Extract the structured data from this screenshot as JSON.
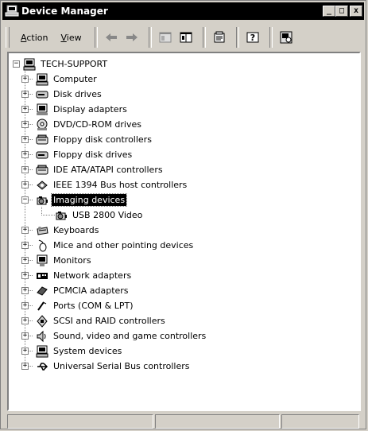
{
  "window": {
    "title": "Device Manager",
    "controls": {
      "minimize": "_",
      "maximize": "□",
      "close": "x"
    }
  },
  "menu": [
    {
      "label": "Action",
      "accel": "A",
      "rest": "ction"
    },
    {
      "label": "View",
      "accel": "V",
      "rest": "iew"
    }
  ],
  "toolbar": [
    {
      "icon": "back-arrow-icon"
    },
    {
      "icon": "forward-arrow-icon"
    },
    {
      "icon": "show-hide-console-tree-icon"
    },
    {
      "icon": "export-list-icon"
    },
    {
      "icon": "properties-icon"
    },
    {
      "icon": "help-icon"
    },
    {
      "icon": "scan-hardware-icon"
    }
  ],
  "tree": {
    "root": "TECH-SUPPORT",
    "items": [
      {
        "label": "Computer",
        "icon": "computer-icon",
        "expanded": false
      },
      {
        "label": "Disk drives",
        "icon": "disk-drive-icon",
        "expanded": false
      },
      {
        "label": "Display adapters",
        "icon": "display-adapter-icon",
        "expanded": false
      },
      {
        "label": "DVD/CD-ROM drives",
        "icon": "cdrom-icon",
        "expanded": false
      },
      {
        "label": "Floppy disk controllers",
        "icon": "floppy-controller-icon",
        "expanded": false
      },
      {
        "label": "Floppy disk drives",
        "icon": "floppy-drive-icon",
        "expanded": false
      },
      {
        "label": "IDE ATA/ATAPI controllers",
        "icon": "ide-controller-icon",
        "expanded": false
      },
      {
        "label": "IEEE 1394 Bus host controllers",
        "icon": "ieee1394-icon",
        "expanded": false
      },
      {
        "label": "Imaging devices",
        "icon": "imaging-device-icon",
        "expanded": true,
        "selected": true,
        "children": [
          {
            "label": "USB 2800 Video",
            "icon": "camera-icon"
          }
        ]
      },
      {
        "label": "Keyboards",
        "icon": "keyboard-icon",
        "expanded": false
      },
      {
        "label": "Mice and other pointing devices",
        "icon": "mouse-icon",
        "expanded": false
      },
      {
        "label": "Monitors",
        "icon": "monitor-icon",
        "expanded": false
      },
      {
        "label": "Network adapters",
        "icon": "network-adapter-icon",
        "expanded": false
      },
      {
        "label": "PCMCIA adapters",
        "icon": "pcmcia-icon",
        "expanded": false
      },
      {
        "label": "Ports (COM & LPT)",
        "icon": "port-icon",
        "expanded": false
      },
      {
        "label": "SCSI and RAID controllers",
        "icon": "scsi-icon",
        "expanded": false
      },
      {
        "label": "Sound, video and game controllers",
        "icon": "sound-icon",
        "expanded": false
      },
      {
        "label": "System devices",
        "icon": "system-device-icon",
        "expanded": false
      },
      {
        "label": "Universal Serial Bus controllers",
        "icon": "usb-icon",
        "expanded": false
      }
    ]
  },
  "status": {
    "panels": [
      "",
      "",
      ""
    ]
  }
}
